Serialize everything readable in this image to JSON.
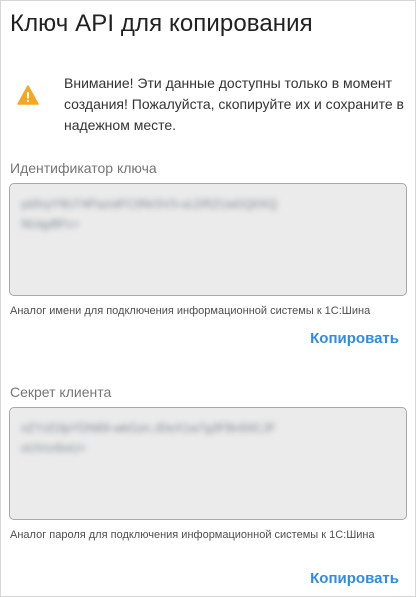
{
  "dialog": {
    "title": "Ключ API для копирования"
  },
  "warning": {
    "icon": "warning-icon",
    "text": "Внимание! Эти данные доступны только в момент создания! Пожалуйста, скопируйте их и сохраните в надежном месте."
  },
  "key_id": {
    "label": "Идентификатор ключа",
    "value": "ydXryY9U74PazotFC0NrSV3-uLDRZUaGQ0XQNUqyBFc=",
    "hint": "Аналог имени для подключения информационной системы к 1С:Шина",
    "copy_label": "Копировать"
  },
  "client_secret": {
    "label": "Секрет клиента",
    "value": "nZYzD3pYDN69-wkGzn.JDeX1w7g3FBn50CJFoUVcn5oU=",
    "hint": "Аналог пароля для подключения информационной системы к 1С:Шина",
    "copy_label": "Копировать"
  },
  "colors": {
    "accent": "#2f8be3",
    "warning": "#f5a623",
    "field_background": "#ebebeb"
  }
}
